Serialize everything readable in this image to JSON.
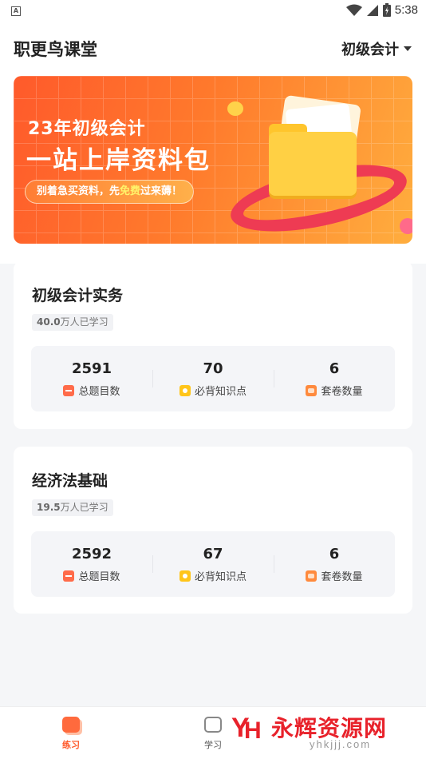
{
  "status_bar": {
    "notification_glyph": "A",
    "time": "5:38",
    "icons": [
      "wifi-icon",
      "signal-icon",
      "battery-icon"
    ]
  },
  "header": {
    "title": "职更鸟课堂",
    "subject_selector": "初级会计"
  },
  "banner": {
    "line1": "23年初级会计",
    "line2": "一站上岸资料包",
    "pill_prefix": "别着急买资料，先",
    "pill_highlight": "免费",
    "pill_suffix": "过来薅！"
  },
  "courses": [
    {
      "name": "初级会计实务",
      "learners_count": "40.0",
      "learners_suffix": "万人已学习",
      "stats": [
        {
          "value": "2591",
          "label": "总题目数",
          "icon": "question-list-icon"
        },
        {
          "value": "70",
          "label": "必背知识点",
          "icon": "star-badge-icon"
        },
        {
          "value": "6",
          "label": "套卷数量",
          "icon": "paper-set-icon"
        }
      ]
    },
    {
      "name": "经济法基础",
      "learners_count": "19.5",
      "learners_suffix": "万人已学习",
      "stats": [
        {
          "value": "2592",
          "label": "总题目数",
          "icon": "question-list-icon"
        },
        {
          "value": "67",
          "label": "必背知识点",
          "icon": "star-badge-icon"
        },
        {
          "value": "6",
          "label": "套卷数量",
          "icon": "paper-set-icon"
        }
      ]
    }
  ],
  "tabbar": {
    "tabs": [
      {
        "label": "练习",
        "active": true
      },
      {
        "label": "学习",
        "active": false
      }
    ]
  },
  "watermark": {
    "text": "永辉资源网",
    "url": "yhkjjj.com",
    "logo_letters": "YH"
  },
  "colors": {
    "accent": "#ff5a2b",
    "banner_start": "#ff5a2b",
    "banner_end": "#ffae3e",
    "watermark_red": "#e8222b"
  }
}
